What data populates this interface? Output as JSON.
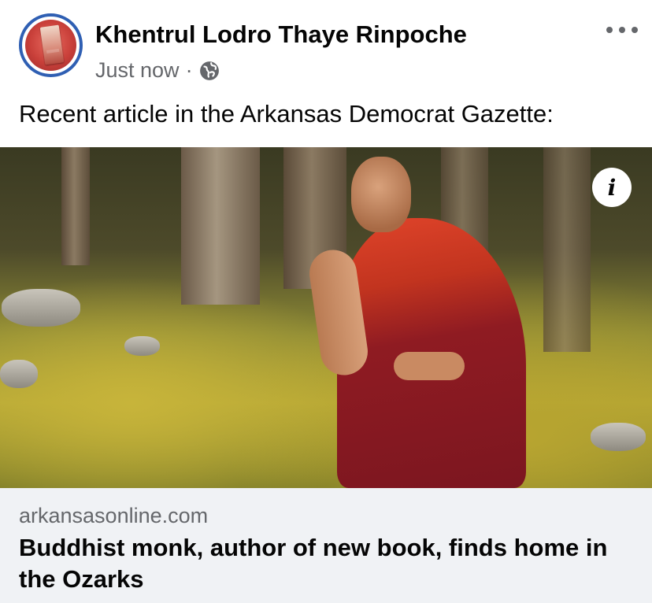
{
  "post": {
    "author": "Khentrul Lodro Thaye Rinpoche",
    "timestamp": "Just now",
    "separator": "·",
    "privacy_icon": "globe-icon",
    "text": "Recent article in the Arkansas Democrat Gazette:"
  },
  "link_preview": {
    "domain": "arkansasonline.com",
    "headline": "Buddhist monk, author of new book, finds home in the Ozarks"
  },
  "icons": {
    "more": "more-options-icon",
    "info": "info-icon"
  },
  "info_glyph": "i",
  "colors": {
    "avatar_ring": "#2f5fb3",
    "secondary_text": "#65676b",
    "link_card_bg": "#f0f2f5"
  }
}
